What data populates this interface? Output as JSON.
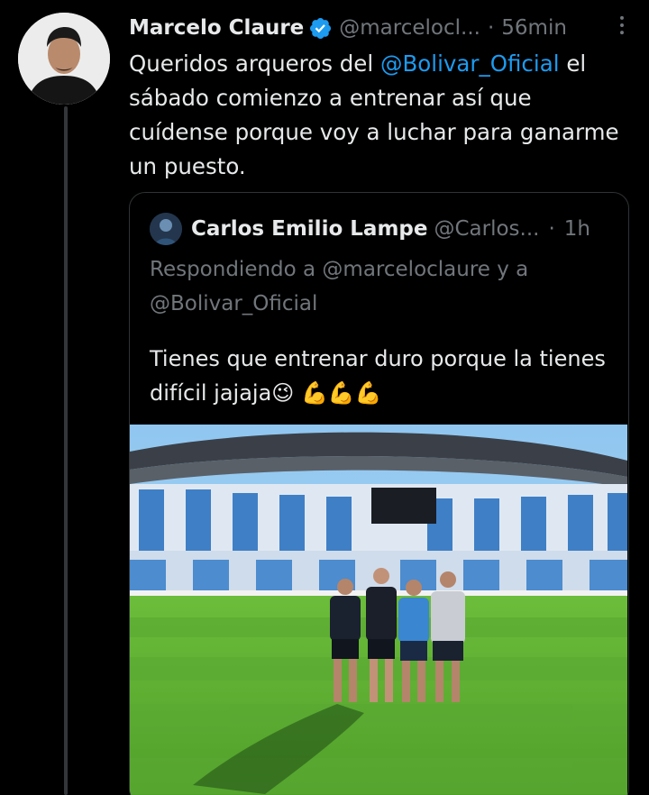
{
  "tweet": {
    "name": "Marcelo Claure",
    "handle": "@marcelocl...",
    "separator": "·",
    "time": "56min",
    "text_pre": "Queridos arqueros del ",
    "mention": "@Bolivar_Oficial",
    "text_post": " el sábado comienzo a entrenar así que cuídense porque voy a luchar para ganarme un puesto."
  },
  "quote": {
    "name": "Carlos Emilio Lampe",
    "handle": "@Carlos...",
    "separator": "·",
    "time": "1h",
    "reply_label": "Respondiendo a @marceloclaure y a @Bolivar_Oficial",
    "text": "Tienes que entrenar duro porque la tienes difícil jajaja😉 💪💪💪"
  },
  "colors": {
    "background": "#000000",
    "text": "#e7e9ea",
    "secondary": "#71767b",
    "accent": "#1d9bf0",
    "border": "#2f3336"
  },
  "icons": {
    "verified": "verified-badge-icon",
    "more": "more-options-icon"
  }
}
